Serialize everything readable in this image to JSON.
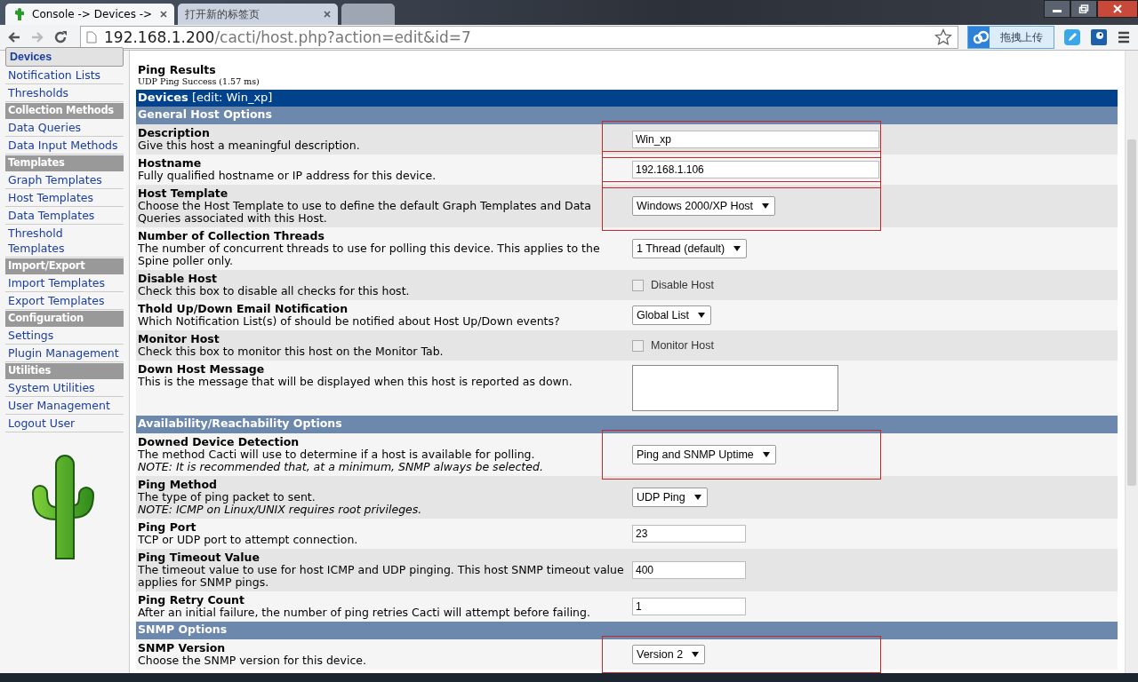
{
  "browser": {
    "tabs": [
      {
        "title": "Console -> Devices -> ",
        "selected": true
      },
      {
        "title": "打开新的标签页",
        "selected": false
      },
      {
        "selected": false
      }
    ],
    "address": {
      "host": "192.168.1.200",
      "path": "/cacti/host.php?action=edit&id=7"
    },
    "extension_button": "拖拽上传"
  },
  "sidebar": {
    "items": [
      {
        "kind": "link",
        "label": "Devices",
        "selected": true
      },
      {
        "kind": "link",
        "label": "Notification Lists",
        "selected": false
      },
      {
        "kind": "link",
        "label": "Thresholds",
        "selected": false
      },
      {
        "kind": "header",
        "label": "Collection Methods"
      },
      {
        "kind": "link",
        "label": "Data Queries",
        "selected": false
      },
      {
        "kind": "link",
        "label": "Data Input Methods",
        "selected": false
      },
      {
        "kind": "header",
        "label": "Templates"
      },
      {
        "kind": "link",
        "label": "Graph Templates",
        "selected": false
      },
      {
        "kind": "link",
        "label": "Host Templates",
        "selected": false
      },
      {
        "kind": "link",
        "label": "Data Templates",
        "selected": false
      },
      {
        "kind": "link",
        "label": "Threshold Templates",
        "selected": false
      },
      {
        "kind": "header",
        "label": "Import/Export"
      },
      {
        "kind": "link",
        "label": "Import Templates",
        "selected": false
      },
      {
        "kind": "link",
        "label": "Export Templates",
        "selected": false
      },
      {
        "kind": "header",
        "label": "Configuration"
      },
      {
        "kind": "link",
        "label": "Settings",
        "selected": false
      },
      {
        "kind": "link",
        "label": "Plugin Management",
        "selected": false
      },
      {
        "kind": "header",
        "label": "Utilities"
      },
      {
        "kind": "link",
        "label": "System Utilities",
        "selected": false
      },
      {
        "kind": "link",
        "label": "User Management",
        "selected": false
      },
      {
        "kind": "link",
        "label": "Logout User",
        "selected": false
      }
    ]
  },
  "ping_results": {
    "title": "Ping Results",
    "result": "UDP Ping Success (1.57 ms)"
  },
  "form": {
    "title": "Devices",
    "subtitle": "[edit: Win_xp]",
    "rows": [
      {
        "kind": "section",
        "title": "General Host Options"
      },
      {
        "kind": "field",
        "title": "Description",
        "description": "Give this host a meaningful description.",
        "control": {
          "kind": "text",
          "value": "Win_xp"
        },
        "highlighted": true
      },
      {
        "kind": "field",
        "title": "Hostname",
        "description": "Fully qualified hostname or IP address for this device.",
        "control": {
          "kind": "text",
          "value": "192.168.1.106"
        },
        "highlighted": true
      },
      {
        "kind": "field",
        "title": "Host Template",
        "description": "Choose the Host Template to use to define the default Graph Templates and Data Queries associated with this Host.",
        "control": {
          "kind": "select",
          "value": "Windows 2000/XP Host"
        },
        "highlighted": true
      },
      {
        "kind": "field",
        "title": "Number of Collection Threads",
        "description": "The number of concurrent threads to use for polling this device. This applies to the Spine poller only.",
        "control": {
          "kind": "select",
          "value": "1 Thread (default)"
        },
        "highlighted": false
      },
      {
        "kind": "field",
        "title": "Disable Host",
        "description": "Check this box to disable all checks for this host.",
        "control": {
          "kind": "checkbox",
          "label": "Disable Host",
          "checked": false
        },
        "highlighted": false
      },
      {
        "kind": "field",
        "title": "Thold Up/Down Email Notification",
        "description": "Which Notification List(s) of should be notified about Host Up/Down events?",
        "control": {
          "kind": "select",
          "value": "Global List"
        },
        "highlighted": false
      },
      {
        "kind": "field",
        "title": "Monitor Host",
        "description": "Check this box to monitor this host on the Monitor Tab.",
        "control": {
          "kind": "checkbox",
          "label": "Monitor Host",
          "checked": false
        },
        "highlighted": false
      },
      {
        "kind": "field",
        "title": "Down Host Message",
        "description": "This is the message that will be displayed when this host is reported as down.",
        "control": {
          "kind": "textarea"
        },
        "highlighted": false
      },
      {
        "kind": "section",
        "title": "Availability/Reachability Options"
      },
      {
        "kind": "field",
        "title": "Downed Device Detection",
        "description": "The method Cacti will use to determine if a host is available for polling.",
        "note": "NOTE: It is recommended that, at a minimum, SNMP always be selected.",
        "control": {
          "kind": "select",
          "value": "Ping and SNMP Uptime"
        },
        "highlighted": true
      },
      {
        "kind": "field",
        "title": "Ping Method",
        "description": "The type of ping packet to sent.",
        "note": "NOTE: ICMP on Linux/UNIX requires root privileges.",
        "control": {
          "kind": "select",
          "value": "UDP Ping"
        },
        "highlighted": false
      },
      {
        "kind": "field",
        "title": "Ping Port",
        "description": "TCP or UDP port to attempt connection.",
        "control": {
          "kind": "text",
          "value": "23"
        },
        "highlighted": false
      },
      {
        "kind": "field",
        "title": "Ping Timeout Value",
        "description": "The timeout value to use for host ICMP and UDP pinging. This host SNMP timeout value applies for SNMP pings.",
        "control": {
          "kind": "text",
          "value": "400"
        },
        "highlighted": false
      },
      {
        "kind": "field",
        "title": "Ping Retry Count",
        "description": "After an initial failure, the number of ping retries Cacti will attempt before failing.",
        "control": {
          "kind": "text",
          "value": "1"
        },
        "highlighted": false
      },
      {
        "kind": "section",
        "title": "SNMP Options"
      },
      {
        "kind": "field",
        "title": "SNMP Version",
        "description": "Choose the SNMP version for this device.",
        "control": {
          "kind": "select",
          "value": "Version 2"
        },
        "highlighted": true
      }
    ]
  }
}
